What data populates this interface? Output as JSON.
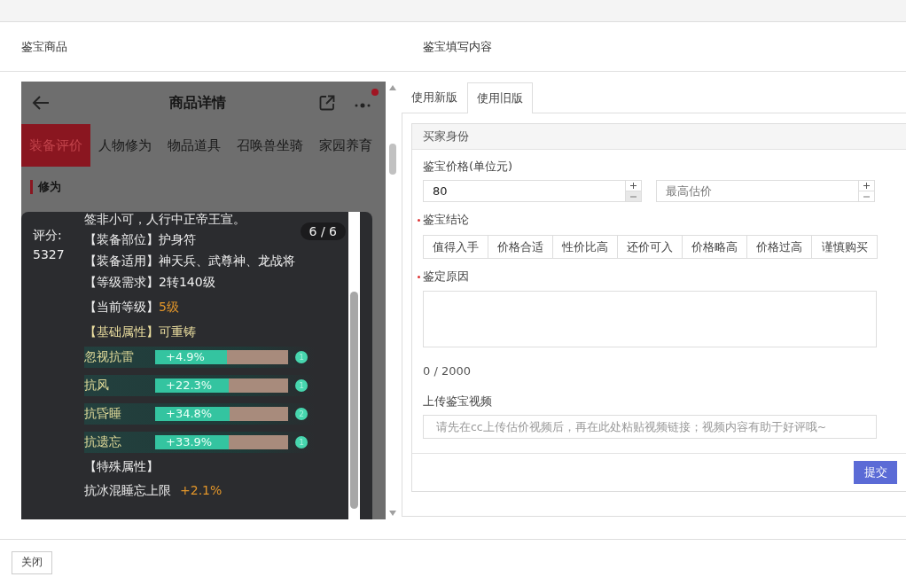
{
  "left_panel": {
    "title": "鉴宝商品"
  },
  "right_panel": {
    "title": "鉴宝填写内容"
  },
  "phone": {
    "title": "商品详情",
    "tabs": [
      {
        "label": "装备评价",
        "selected": true
      },
      {
        "label": "人物修为",
        "selected": false
      },
      {
        "label": "物品道具",
        "selected": false
      },
      {
        "label": "召唤兽坐骑",
        "selected": false
      },
      {
        "label": "家园养育",
        "selected": false
      }
    ],
    "section": "修为",
    "has_notification": true
  },
  "popup": {
    "score_label": "评分:",
    "score": "5327",
    "counter": "6 / 6",
    "intro": "签非小可，人行中正帝王宣。",
    "lines": [
      {
        "label": "【装备部位】",
        "value": "护身符",
        "kind": "plain"
      },
      {
        "label": "【装备适用】",
        "value": "神天兵、武尊神、龙战将",
        "kind": "plain"
      },
      {
        "label": "【等级需求】",
        "value": "2转140级",
        "kind": "plain"
      },
      {
        "label": "【当前等级】",
        "value": "5级",
        "kind": "level"
      },
      {
        "label": "【基础属性】",
        "value": "可重铸",
        "kind": "base"
      }
    ],
    "attributes": [
      {
        "name": "忽视抗雷",
        "reading": "+4.9%",
        "level": 0.54,
        "badge": "1"
      },
      {
        "name": "抗风",
        "reading": "+22.3%",
        "level": 0.55,
        "badge": "1"
      },
      {
        "name": "抗昏睡",
        "reading": "+34.8%",
        "level": 0.56,
        "badge": "2"
      },
      {
        "name": "抗遗忘",
        "reading": "+33.9%",
        "level": 0.55,
        "badge": "1"
      }
    ],
    "special_title": "【特殊属性】",
    "special": {
      "name": "抗冰混睡忘上限",
      "reading": "+2.1%"
    }
  },
  "form": {
    "tabs": [
      {
        "label": "使用新版",
        "selected": false
      },
      {
        "label": "使用旧版",
        "selected": true
      }
    ],
    "section": "买家身份",
    "price_label": "鉴宝价格(单位元)",
    "price": {
      "value": "80",
      "minus_disabled": true
    },
    "max_price": {
      "placeholder": "最高估价",
      "minus_disabled": false
    },
    "conclusion": {
      "label": "鉴宝结论",
      "required": true,
      "options": [
        {
          "label": "值得入手",
          "selected": false
        },
        {
          "label": "价格合适",
          "selected": false
        },
        {
          "label": "性价比高",
          "selected": false
        },
        {
          "label": "还价可入",
          "selected": false
        },
        {
          "label": "价格略高",
          "selected": false
        },
        {
          "label": "价格过高",
          "selected": false
        },
        {
          "label": "谨慎购买",
          "selected": false
        }
      ]
    },
    "reason": {
      "label": "鉴定原因",
      "required": true,
      "counter": "0 / 2000"
    },
    "video": {
      "label": "上传鉴宝视频",
      "placeholder": "请先在cc上传估价视频后，再在此处粘贴视频链接；视频内容有助于好评哦~"
    },
    "submit": "提交"
  },
  "footer": {
    "close": "关闭"
  }
}
